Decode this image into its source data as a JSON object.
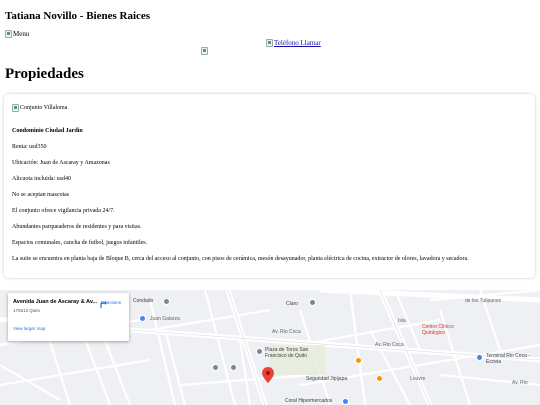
{
  "header": {
    "site_title": "Tatiana Novillo - Bienes Raices",
    "menu_alt": "Menu",
    "phone_link_text": "Teléfono Llamar"
  },
  "main": {
    "section_title": "Propiedades"
  },
  "property": {
    "photo_alt": "Conjunto Villaloma",
    "name": "Condominio Ciudad Jardin",
    "details": [
      "Renta: usd350",
      "Ubicación: Juan de Ascaray y Amazonas",
      "Alicuota incluida: usd40",
      "No se aceptan mascotas",
      "El conjunto ofrece vigilancia privada 24/7.",
      "Abundantes parqueaderos de residentes y para visitas.",
      "Espacios comunales, cancha de futbol, juegos infantiles.",
      "La suite se encuentra en planta baja de Bloque B, cerca del acceso al conjunto, con pisos de cerámica, mesón desayunador, planta eléctrica de cocina, extractor de olores, lavadora y secadora."
    ]
  },
  "map": {
    "place_title": "Avenida Juan de Ascaray & Av...",
    "place_subtitle": "170513 Quito",
    "directions_label": "Directions",
    "larger_map_label": "View larger map",
    "labels": {
      "condado": "Condado",
      "claro": "Claro",
      "juan_galarza": "Juan Galarza",
      "av_rio_coca_1": "Av. Rio Coca",
      "av_rio_coca_2": "Av. Rio Coca",
      "plaza_toros": "Plaza de Toros San Francisco de Quito",
      "centro_clinico": "Centro Clínico Quirúrgico",
      "terminal": "Terminal Rio Coca - Ecovia",
      "seguridad": "Seguridad Jipijapa",
      "los_tulipanes": "de los Tulipanes",
      "louvre": "Louvre",
      "coral": "Coral Hipermercados",
      "calle_isla": "Isla",
      "av_rio": "Av. Rio"
    },
    "colors": {
      "background": "#eef0f3",
      "main_road": "#ffffff",
      "water_green": "#c8e6c9",
      "pin": "#ea4335",
      "link": "#1a73e8"
    }
  }
}
